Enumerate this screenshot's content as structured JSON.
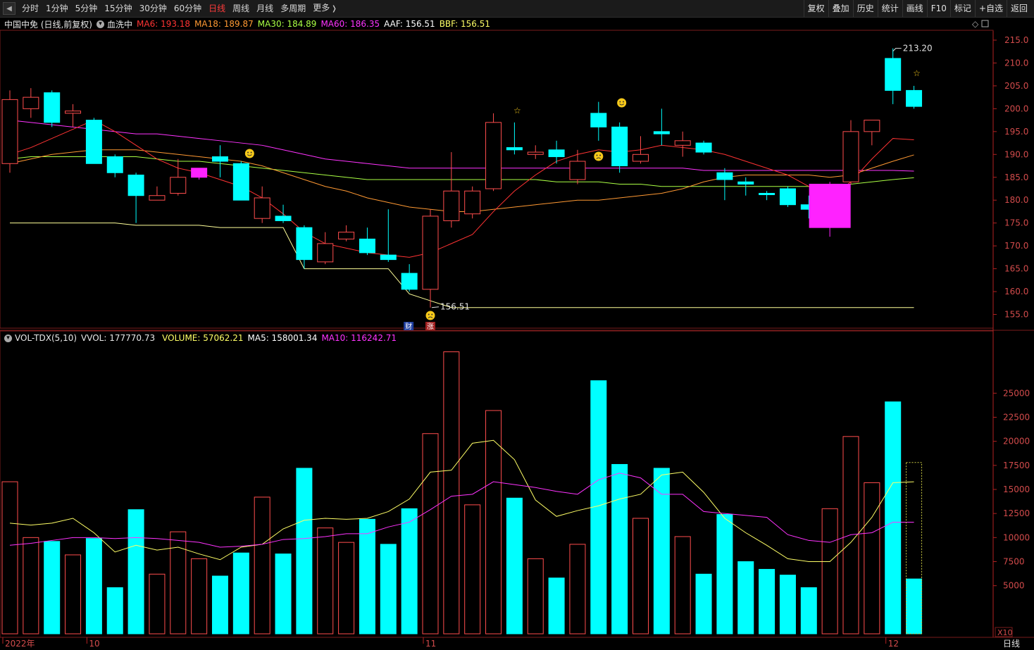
{
  "toolbar": {
    "tabs": [
      "分时",
      "1分钟",
      "5分钟",
      "15分钟",
      "30分钟",
      "60分钟",
      "日线",
      "周线",
      "月线",
      "多周期",
      "更多"
    ],
    "active": "日线",
    "right": [
      "复权",
      "叠加",
      "历史",
      "统计",
      "画线",
      "F10",
      "标记",
      "+自选",
      "返回"
    ]
  },
  "info": {
    "stock": "中国中免 (日线,前复权)",
    "indicator": "血洗中",
    "ma6": "MA6: 193.18",
    "ma18": "MA18: 189.87",
    "ma30": "MA30: 184.89",
    "ma60": "MA60: 186.35",
    "aaf": "AAF: 156.51",
    "bbf": "BBF: 156.51"
  },
  "vol_info": {
    "name": "VOL-TDX(5,10)",
    "vvol": "VVOL: 177770.73",
    "volume": "VOLUME: 57062.21",
    "ma5": "MA5: 158001.34",
    "ma10": "MA10: 116242.71"
  },
  "colors": {
    "up": "#ff4d4d",
    "down": "#00ffff",
    "ma6": "#ff3333",
    "ma18": "#ff9933",
    "ma30": "#aaff44",
    "ma60": "#ff33ff",
    "support": "#ffff99",
    "special": "#ff22ff"
  },
  "chart_data": {
    "type": "candlestick",
    "price_ylim": [
      152,
      217
    ],
    "price_ticks": [
      "215.0",
      "210.0",
      "205.0",
      "200.0",
      "195.0",
      "190.0",
      "185.0",
      "180.0",
      "175.0",
      "170.0",
      "165.0",
      "160.0",
      "155.0"
    ],
    "volume_ylim": [
      0,
      30000
    ],
    "volume_ticks": [
      "25000",
      "22500",
      "20000",
      "17500",
      "15000",
      "12500",
      "10000",
      "7500",
      "5000"
    ],
    "x_labels": [
      {
        "i": 0,
        "label": "2022年"
      },
      {
        "i": 4,
        "label": "10"
      },
      {
        "i": 20,
        "label": "11"
      },
      {
        "i": 42,
        "label": "12"
      }
    ],
    "candles": [
      {
        "o": 188,
        "c": 202,
        "h": 204,
        "l": 186,
        "v": 15800,
        "up": true
      },
      {
        "o": 200,
        "c": 202.5,
        "h": 204.5,
        "l": 198,
        "v": 10000,
        "up": true
      },
      {
        "o": 203.5,
        "c": 197,
        "h": 204,
        "l": 196,
        "v": 9600,
        "up": false
      },
      {
        "o": 199,
        "c": 199.5,
        "h": 201,
        "l": 196,
        "v": 8200,
        "up": true
      },
      {
        "o": 197.5,
        "c": 188,
        "h": 198,
        "l": 188,
        "v": 9900,
        "up": false
      },
      {
        "o": 189.5,
        "c": 186,
        "h": 190,
        "l": 185,
        "v": 4800,
        "up": false
      },
      {
        "o": 185.5,
        "c": 181,
        "h": 186,
        "l": 175,
        "v": 12900,
        "up": false
      },
      {
        "o": 180,
        "c": 181,
        "h": 183,
        "l": 180,
        "v": 6200,
        "up": true
      },
      {
        "o": 181.5,
        "c": 185,
        "h": 189,
        "l": 181,
        "v": 10600,
        "up": true
      },
      {
        "o": 185,
        "c": 187,
        "h": 187,
        "l": 184.5,
        "v": 7800,
        "up": true,
        "special": true
      },
      {
        "o": 189.5,
        "c": 188.5,
        "h": 192,
        "l": 185,
        "v": 6000,
        "up": false
      },
      {
        "o": 188,
        "c": 180,
        "h": 188.5,
        "l": 180,
        "v": 8400,
        "up": false
      },
      {
        "o": 176,
        "c": 180.5,
        "h": 183,
        "l": 175,
        "v": 14200,
        "up": true
      },
      {
        "o": 176.5,
        "c": 175.5,
        "h": 179,
        "l": 175,
        "v": 8300,
        "up": false
      },
      {
        "o": 174,
        "c": 167,
        "h": 174.5,
        "l": 165,
        "v": 17200,
        "up": false
      },
      {
        "o": 166.5,
        "c": 170.5,
        "h": 173,
        "l": 166,
        "v": 11000,
        "up": true
      },
      {
        "o": 171.5,
        "c": 173,
        "h": 174.5,
        "l": 171,
        "v": 9500,
        "up": true
      },
      {
        "o": 171.5,
        "c": 168.5,
        "h": 174,
        "l": 168,
        "v": 11900,
        "up": false
      },
      {
        "o": 168,
        "c": 167,
        "h": 178,
        "l": 166.5,
        "v": 9300,
        "up": false
      },
      {
        "o": 164,
        "c": 160.5,
        "h": 166,
        "l": 160,
        "v": 13000,
        "up": false
      },
      {
        "o": 160.5,
        "c": 176.5,
        "h": 178,
        "l": 156.5,
        "v": 20800,
        "up": true
      },
      {
        "o": 175.5,
        "c": 182,
        "h": 190.5,
        "l": 174,
        "v": 29300,
        "up": true
      },
      {
        "o": 177,
        "c": 182,
        "h": 183,
        "l": 176,
        "v": 13400,
        "up": true
      },
      {
        "o": 182.5,
        "c": 197,
        "h": 199,
        "l": 182,
        "v": 23200,
        "up": true
      },
      {
        "o": 191.5,
        "c": 191,
        "h": 197,
        "l": 190,
        "v": 14100,
        "up": false
      },
      {
        "o": 190,
        "c": 190.5,
        "h": 192,
        "l": 189,
        "v": 7800,
        "up": true
      },
      {
        "o": 191,
        "c": 189.5,
        "h": 193,
        "l": 188,
        "v": 5800,
        "up": false
      },
      {
        "o": 184.5,
        "c": 188.5,
        "h": 191,
        "l": 183.5,
        "v": 9300,
        "up": true
      },
      {
        "o": 199,
        "c": 196,
        "h": 201.5,
        "l": 193,
        "v": 26300,
        "up": false
      },
      {
        "o": 196,
        "c": 187.5,
        "h": 197,
        "l": 186,
        "v": 17600,
        "up": false
      },
      {
        "o": 188.5,
        "c": 190,
        "h": 194,
        "l": 188,
        "v": 12000,
        "up": true
      },
      {
        "o": 195,
        "c": 194.5,
        "h": 200,
        "l": 192,
        "v": 17200,
        "up": false
      },
      {
        "o": 192,
        "c": 193,
        "h": 195,
        "l": 189.5,
        "v": 10100,
        "up": true
      },
      {
        "o": 192.5,
        "c": 190.5,
        "h": 193,
        "l": 190,
        "v": 6200,
        "up": false
      },
      {
        "o": 186,
        "c": 184.5,
        "h": 187,
        "l": 180,
        "v": 12400,
        "up": false
      },
      {
        "o": 184,
        "c": 183.5,
        "h": 185,
        "l": 181,
        "v": 7500,
        "up": false
      },
      {
        "o": 181.5,
        "c": 181.5,
        "h": 182,
        "l": 180,
        "v": 6700,
        "up": false
      },
      {
        "o": 182.5,
        "c": 179,
        "h": 183,
        "l": 178.5,
        "v": 6100,
        "up": false
      },
      {
        "o": 179,
        "c": 178,
        "h": 181,
        "l": 176,
        "v": 4800,
        "up": false
      },
      {
        "o": 183.5,
        "c": 174,
        "h": 184,
        "l": 172,
        "v": 13000,
        "up": true,
        "special": true
      },
      {
        "o": 184,
        "c": 195,
        "h": 197.5,
        "l": 183.5,
        "v": 20500,
        "up": true
      },
      {
        "o": 195,
        "c": 197.5,
        "h": 197.5,
        "l": 192,
        "v": 15700,
        "up": true
      },
      {
        "o": 204,
        "c": 211,
        "h": 213.2,
        "l": 201,
        "v": 24100,
        "up": false
      },
      {
        "o": 204,
        "c": 200.5,
        "h": 205,
        "l": 200,
        "v": 5700,
        "up": false
      }
    ],
    "ma6": [
      190,
      191.5,
      193.5,
      195.5,
      197.5,
      195,
      192,
      189,
      187,
      186,
      184.5,
      183,
      180.5,
      177,
      173,
      170.5,
      169.5,
      168.5,
      168,
      167.5,
      168.5,
      170.5,
      172.5,
      177.5,
      182,
      185.5,
      188.5,
      190,
      191,
      190.5,
      191,
      192,
      191.5,
      191,
      190,
      188.5,
      187,
      185.5,
      183,
      180.5,
      184,
      189,
      193.5,
      193.2
    ],
    "ma18": [
      188,
      189,
      190,
      190.5,
      191,
      191,
      191,
      190.5,
      190,
      189.5,
      189,
      188.5,
      187.5,
      186,
      184.5,
      183,
      182,
      180.5,
      179.5,
      178.5,
      178,
      177.5,
      177.5,
      178,
      178.5,
      179,
      179.5,
      180,
      180,
      180.5,
      181,
      181.5,
      182.5,
      184,
      185,
      185.5,
      185.5,
      185.5,
      185.5,
      185,
      185.5,
      187,
      188.5,
      189.9
    ],
    "ma30": [
      189,
      189.5,
      189.5,
      189.5,
      189.5,
      189.5,
      189.5,
      189,
      188.5,
      188.5,
      188,
      187.5,
      187,
      186.5,
      186,
      185.5,
      185,
      184.5,
      184.5,
      184.5,
      184.5,
      184.5,
      184.5,
      184.5,
      184.5,
      184.5,
      184,
      184,
      184,
      183.5,
      183.5,
      183,
      183,
      183,
      183,
      183,
      183,
      183,
      183,
      183,
      183.5,
      184,
      184.5,
      184.9
    ],
    "ma60": [
      197.5,
      197,
      196.5,
      196,
      195.5,
      195,
      194.5,
      194.5,
      194,
      193.5,
      193,
      192.5,
      192,
      191,
      190,
      189,
      188.5,
      188,
      187.5,
      187,
      187,
      187,
      187,
      187,
      187,
      187,
      187,
      187,
      187,
      187,
      187,
      187,
      187,
      186.5,
      186.5,
      186.5,
      186.5,
      186.5,
      186.5,
      186.5,
      186.5,
      186.5,
      186.5,
      186.35
    ],
    "support": [
      175,
      175,
      175,
      175,
      175,
      175,
      174.5,
      174.5,
      174.5,
      174.5,
      174,
      174,
      174,
      174,
      165,
      165,
      165,
      165,
      165,
      159.5,
      158,
      156.5,
      156.5,
      156.5,
      156.5,
      156.5,
      156.5,
      156.5,
      156.5,
      156.5,
      156.5,
      156.5,
      156.5,
      156.5,
      156.5,
      156.5,
      156.5,
      156.5,
      156.5,
      156.5,
      156.5,
      156.5,
      156.5,
      156.51
    ],
    "vol_ma5": [
      11500,
      11300,
      11500,
      12000,
      10500,
      8500,
      9200,
      8700,
      9000,
      8300,
      7700,
      9000,
      9300,
      10900,
      11800,
      12000,
      11900,
      12000,
      12700,
      14000,
      16800,
      17000,
      19800,
      20100,
      18100,
      13900,
      12200,
      12800,
      13300,
      14000,
      14500,
      16500,
      16800,
      14700,
      12000,
      10500,
      9200,
      7800,
      7500,
      7500,
      9500,
      12100,
      15700,
      15800
    ],
    "vol_ma10": [
      9200,
      9400,
      9700,
      10000,
      10000,
      9900,
      10000,
      9900,
      9700,
      9500,
      9000,
      9100,
      9300,
      9800,
      9900,
      10100,
      10400,
      10400,
      11100,
      11600,
      12900,
      14300,
      14500,
      15800,
      15500,
      15200,
      14800,
      14500,
      16000,
      16700,
      16200,
      14500,
      14500,
      12700,
      12500,
      12300,
      12100,
      10300,
      9700,
      9500,
      10300,
      10500,
      11600,
      11600
    ],
    "annotations": {
      "high_label": "213.20",
      "low_label": "156.51",
      "badge_cai": "财",
      "badge_zhang": "涨",
      "period": "日线",
      "x10": "X10"
    }
  }
}
